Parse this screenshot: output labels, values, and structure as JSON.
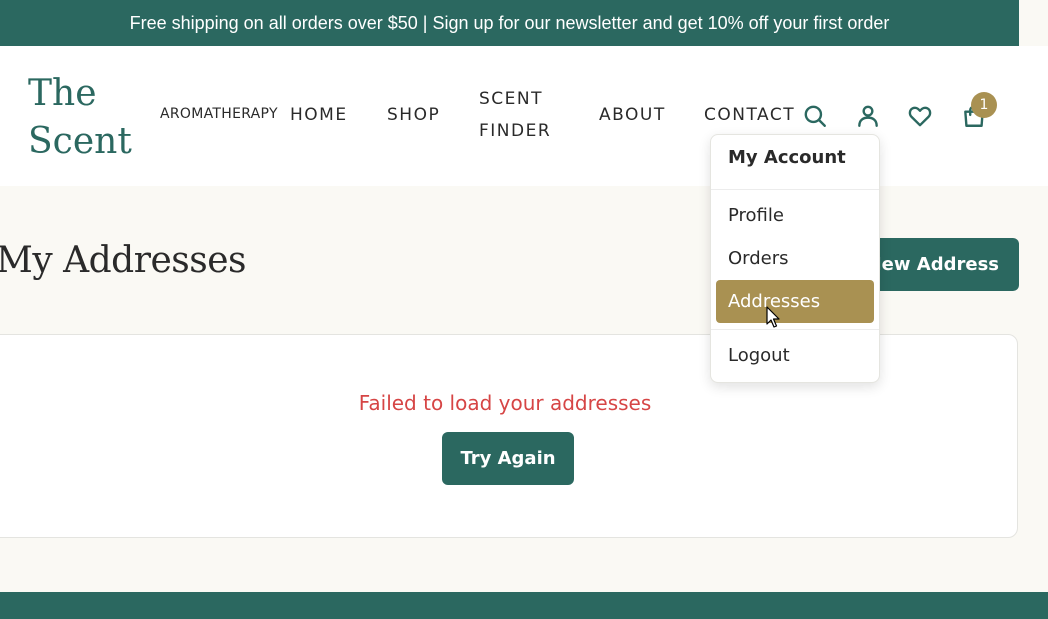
{
  "banner": {
    "text": "Free shipping on all orders over $50 | Sign up for our newsletter and get 10% off your first order"
  },
  "logo": {
    "line1": "The",
    "line2": "Scent"
  },
  "tagline": "AROMATHERAPY",
  "nav": [
    {
      "label": "HOME"
    },
    {
      "label": "SHOP"
    },
    {
      "label": "SCENT"
    },
    {
      "label": "FINDER"
    },
    {
      "label": "ABOUT"
    },
    {
      "label": "CONTACT"
    }
  ],
  "header_icons": {
    "search": "search-icon",
    "account": "user-icon",
    "wishlist": "heart-icon",
    "cart": "bag-icon"
  },
  "cart": {
    "count": "1"
  },
  "page": {
    "title": "My Addresses",
    "add_button": "New Address"
  },
  "error": {
    "message": "Failed to load your addresses",
    "retry": "Try Again"
  },
  "account_menu": {
    "title": "My Account",
    "items": [
      {
        "label": "Profile"
      },
      {
        "label": "Orders"
      },
      {
        "label": "Addresses"
      },
      {
        "label": "Logout"
      }
    ],
    "active": "Addresses"
  },
  "colors": {
    "primary": "#2b6860",
    "accent": "#a99152",
    "error": "#d64545",
    "background": "#faf9f4"
  }
}
